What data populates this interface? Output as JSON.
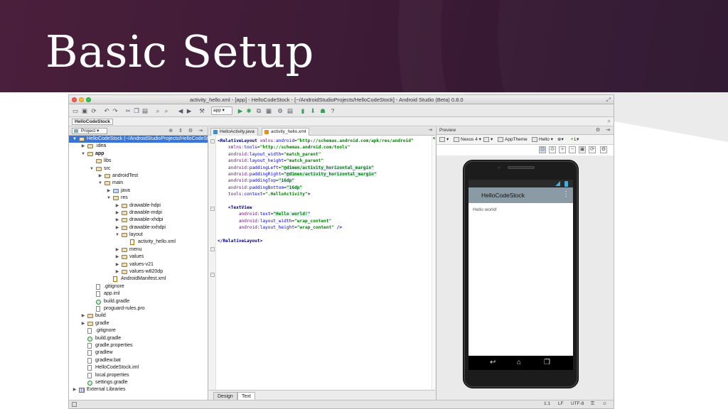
{
  "slide": {
    "title": "Basic Setup"
  },
  "window": {
    "title": "activity_hello.xml - [app] - HelloCodeStock - [~/AndroidStudioProjects/HelloCodeStock] - Android Studio (Beta) 0.8.0"
  },
  "toolbar": {
    "run_config": "app"
  },
  "navbar": {
    "crumb": "HelloCodeStock"
  },
  "project_panel": {
    "selector": "Project",
    "tree": [
      {
        "label": "HelloCodeStock (~/AndroidStudioProjects/HelloCodeStock)",
        "depth": 0,
        "arrow": "▼",
        "icon": "folder",
        "selected": true
      },
      {
        "label": ".idea",
        "depth": 1,
        "arrow": "▶",
        "icon": "folder"
      },
      {
        "label": "app",
        "depth": 1,
        "arrow": "▼",
        "icon": "folder",
        "bold": true
      },
      {
        "label": "libs",
        "depth": 2,
        "arrow": "",
        "icon": "folder"
      },
      {
        "label": "src",
        "depth": 2,
        "arrow": "▼",
        "icon": "folder"
      },
      {
        "label": "androidTest",
        "depth": 3,
        "arrow": "▶",
        "icon": "folder"
      },
      {
        "label": "main",
        "depth": 3,
        "arrow": "▼",
        "icon": "folder"
      },
      {
        "label": "java",
        "depth": 4,
        "arrow": "▶",
        "icon": "folder blue"
      },
      {
        "label": "res",
        "depth": 4,
        "arrow": "▼",
        "icon": "folder"
      },
      {
        "label": "drawable-hdpi",
        "depth": 5,
        "arrow": "▶",
        "icon": "folder"
      },
      {
        "label": "drawable-mdpi",
        "depth": 5,
        "arrow": "▶",
        "icon": "folder"
      },
      {
        "label": "drawable-xhdpi",
        "depth": 5,
        "arrow": "▶",
        "icon": "folder"
      },
      {
        "label": "drawable-xxhdpi",
        "depth": 5,
        "arrow": "▶",
        "icon": "folder"
      },
      {
        "label": "layout",
        "depth": 5,
        "arrow": "▼",
        "icon": "folder"
      },
      {
        "label": "activity_hello.xml",
        "depth": 6,
        "arrow": "",
        "icon": "xml"
      },
      {
        "label": "menu",
        "depth": 5,
        "arrow": "▶",
        "icon": "folder"
      },
      {
        "label": "values",
        "depth": 5,
        "arrow": "▶",
        "icon": "folder"
      },
      {
        "label": "values-v21",
        "depth": 5,
        "arrow": "▶",
        "icon": "folder"
      },
      {
        "label": "values-w820dp",
        "depth": 5,
        "arrow": "▶",
        "icon": "folder"
      },
      {
        "label": "AndroidManifest.xml",
        "depth": 4,
        "arrow": "",
        "icon": "xml"
      },
      {
        "label": ".gitignore",
        "depth": 2,
        "arrow": "",
        "icon": "file"
      },
      {
        "label": "app.iml",
        "depth": 2,
        "arrow": "",
        "icon": "file"
      },
      {
        "label": "build.gradle",
        "depth": 2,
        "arrow": "",
        "icon": "gradle"
      },
      {
        "label": "proguard-rules.pro",
        "depth": 2,
        "arrow": "",
        "icon": "file"
      },
      {
        "label": "build",
        "depth": 1,
        "arrow": "▶",
        "icon": "folder"
      },
      {
        "label": "gradle",
        "depth": 1,
        "arrow": "▶",
        "icon": "folder"
      },
      {
        "label": ".gitignore",
        "depth": 1,
        "arrow": "",
        "icon": "file"
      },
      {
        "label": "build.gradle",
        "depth": 1,
        "arrow": "",
        "icon": "gradle"
      },
      {
        "label": "gradle.properties",
        "depth": 1,
        "arrow": "",
        "icon": "file"
      },
      {
        "label": "gradlew",
        "depth": 1,
        "arrow": "",
        "icon": "file"
      },
      {
        "label": "gradlew.bat",
        "depth": 1,
        "arrow": "",
        "icon": "file"
      },
      {
        "label": "HelloCodeStock.iml",
        "depth": 1,
        "arrow": "",
        "icon": "file"
      },
      {
        "label": "local.properties",
        "depth": 1,
        "arrow": "",
        "icon": "file"
      },
      {
        "label": "settings.gradle",
        "depth": 1,
        "arrow": "",
        "icon": "gradle"
      },
      {
        "label": "External Libraries",
        "depth": 0,
        "arrow": "▶",
        "icon": "lib"
      }
    ]
  },
  "editor": {
    "tabs": [
      {
        "label": "HelloActivity.java",
        "active": false
      },
      {
        "label": "activity_hello.xml",
        "active": true
      }
    ],
    "bottom_tabs": [
      {
        "label": "Design",
        "active": false
      },
      {
        "label": "Text",
        "active": true
      }
    ],
    "code_lines": [
      [
        [
          "c-tag",
          "<RelativeLayout "
        ],
        [
          "c-ns",
          "xmlns:"
        ],
        [
          "c-attr",
          "android"
        ],
        [
          "c-punct",
          "="
        ],
        [
          "c-val",
          "\"http://schemas.android.com/apk/res/android\""
        ]
      ],
      [
        [
          "c-punct",
          "    "
        ],
        [
          "c-ns",
          "xmlns:"
        ],
        [
          "c-attr",
          "tools"
        ],
        [
          "c-punct",
          "="
        ],
        [
          "c-val",
          "\"http://schemas.android.com/tools\""
        ]
      ],
      [
        [
          "c-punct",
          "    "
        ],
        [
          "c-ns",
          "android:"
        ],
        [
          "c-attr",
          "layout_width"
        ],
        [
          "c-punct",
          "="
        ],
        [
          "c-val",
          "\"match_parent\""
        ]
      ],
      [
        [
          "c-punct",
          "    "
        ],
        [
          "c-ns",
          "android:"
        ],
        [
          "c-attr",
          "layout_height"
        ],
        [
          "c-punct",
          "="
        ],
        [
          "c-val",
          "\"match_parent\""
        ]
      ],
      [
        [
          "c-punct",
          "    "
        ],
        [
          "c-ns",
          "android:"
        ],
        [
          "c-attr",
          "paddingLeft"
        ],
        [
          "c-punct",
          "="
        ],
        [
          "c-val hl-val",
          "\"@dimen/activity_horizontal_margin\""
        ]
      ],
      [
        [
          "c-punct",
          "    "
        ],
        [
          "c-ns",
          "android:"
        ],
        [
          "c-attr",
          "paddingRight"
        ],
        [
          "c-punct",
          "="
        ],
        [
          "c-val hl-val",
          "\"@dimen/activity_horizontal_margin\""
        ]
      ],
      [
        [
          "c-punct",
          "    "
        ],
        [
          "c-ns",
          "android:"
        ],
        [
          "c-attr",
          "paddingTop"
        ],
        [
          "c-punct",
          "="
        ],
        [
          "c-val hl-val",
          "\"16dp\""
        ]
      ],
      [
        [
          "c-punct",
          "    "
        ],
        [
          "c-ns",
          "android:"
        ],
        [
          "c-attr",
          "paddingBottom"
        ],
        [
          "c-punct",
          "="
        ],
        [
          "c-val hl-val",
          "\"16dp\""
        ]
      ],
      [
        [
          "c-punct",
          "    "
        ],
        [
          "c-ns",
          "tools:"
        ],
        [
          "c-attr",
          "context"
        ],
        [
          "c-punct",
          "="
        ],
        [
          "c-val",
          "\".HelloActivity\""
        ],
        [
          "c-tag",
          ">"
        ]
      ],
      [],
      [
        [
          "c-punct",
          "    "
        ],
        [
          "c-tag",
          "<TextView"
        ]
      ],
      [
        [
          "c-punct",
          "        "
        ],
        [
          "c-ns",
          "android:"
        ],
        [
          "c-attr",
          "text"
        ],
        [
          "c-punct",
          "="
        ],
        [
          "c-val hl-val",
          "\"Hello world!\""
        ]
      ],
      [
        [
          "c-punct",
          "        "
        ],
        [
          "c-ns",
          "android:"
        ],
        [
          "c-attr",
          "layout_width"
        ],
        [
          "c-punct",
          "="
        ],
        [
          "c-val",
          "\"wrap_content\""
        ]
      ],
      [
        [
          "c-punct",
          "        "
        ],
        [
          "c-ns",
          "android:"
        ],
        [
          "c-attr",
          "layout_height"
        ],
        [
          "c-punct",
          "="
        ],
        [
          "c-val",
          "\"wrap_content\""
        ],
        [
          "c-tag",
          " />"
        ]
      ],
      [],
      [
        [
          "c-tag",
          "</RelativeLayout>"
        ]
      ]
    ]
  },
  "preview": {
    "header": "Preview",
    "device": "Nexus 4",
    "theme": "AppTheme",
    "activity": "Hello",
    "api": "L",
    "app_title": "HelloCodeStock",
    "hello_text": "Hello world!"
  },
  "status": {
    "position": "1:1",
    "line_sep": "LF",
    "encoding": "UTF-8"
  }
}
